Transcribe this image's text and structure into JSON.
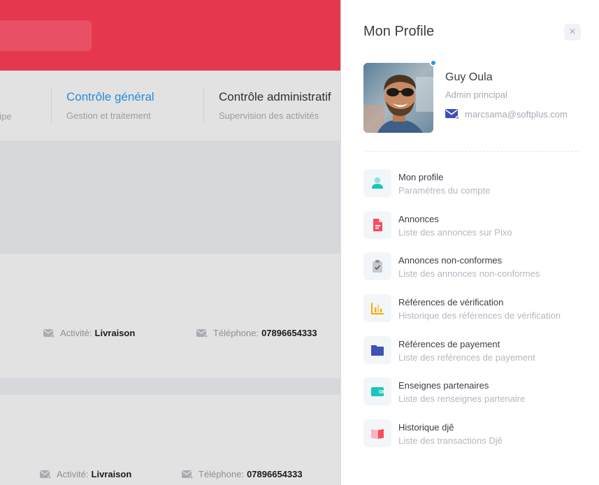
{
  "background": {
    "nav": [
      {
        "title": "",
        "subtitle": "uipe"
      },
      {
        "title": "Contrôle général",
        "subtitle": "Gestion et traitement"
      },
      {
        "title": "Contrôle administratif",
        "subtitle": "Supervision des activités"
      }
    ],
    "cards": [
      {
        "activity_label": "Activité:",
        "activity_value": "Livraison",
        "phone_label": "Téléphone:",
        "phone_value": "07896654333"
      },
      {
        "activity_label": "Activité:",
        "activity_value": "Livraison",
        "phone_label": "Téléphone:",
        "phone_value": "07896654333"
      }
    ]
  },
  "panel": {
    "title": "Mon Profile",
    "close_label": "×",
    "user": {
      "name": "Guy Oula",
      "role": "Admin principal",
      "email": "marcsama@softplus.com"
    },
    "menu": [
      {
        "title": "Mon profile",
        "subtitle": "Paramètres du compte",
        "icon": "user-icon",
        "color": "#1bc5bd"
      },
      {
        "title": "Annonces",
        "subtitle": "Liste des annonces sur Pixo",
        "icon": "document-icon",
        "color": "#f64e60"
      },
      {
        "title": "Annonces non-conformes",
        "subtitle": "Liste des annonces non-conformes",
        "icon": "clipboard-check-icon",
        "color": "#b5b5c3"
      },
      {
        "title": "Références de vérification",
        "subtitle": "Historique des références de vérification",
        "icon": "bar-chart-icon",
        "color": "#ffa800"
      },
      {
        "title": "Références de payement",
        "subtitle": "Liste des reférences de payement",
        "icon": "folder-icon",
        "color": "#3f51b5"
      },
      {
        "title": "Enseignes partenaires",
        "subtitle": "Liste des renseignes partenaire",
        "icon": "wallet-icon",
        "color": "#1bc5bd"
      },
      {
        "title": "Historique djê",
        "subtitle": "Liste des transactions Djê",
        "icon": "book-icon",
        "color": "#f64e60"
      }
    ]
  }
}
